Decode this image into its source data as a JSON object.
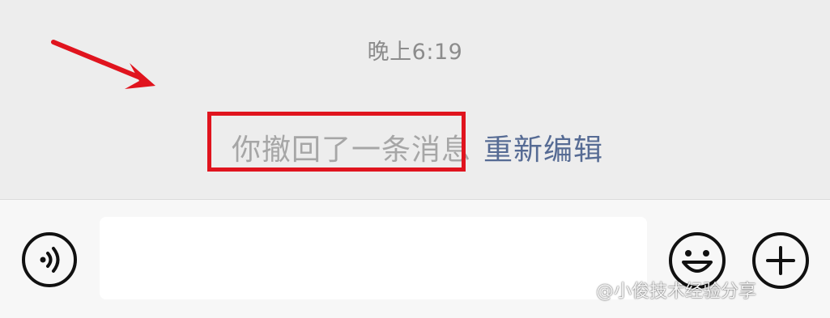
{
  "chat": {
    "timestamp": "晚上6:19",
    "recall_notice": "你撤回了一条消息",
    "reedit_label": "重新编辑"
  },
  "input_bar": {
    "message_value": "",
    "voice_icon": "voice-icon",
    "emoji_icon": "emoji-smile-icon",
    "plus_icon": "plus-circle-icon"
  },
  "annotation": {
    "arrow_color": "#e0141e",
    "box_color": "#e0141e"
  },
  "watermark": {
    "text": "@小俊技术经验分享"
  },
  "colors": {
    "background": "#ededed",
    "input_bar": "#f7f7f7",
    "link": "#566b94",
    "muted_text": "#a6a6a6"
  }
}
